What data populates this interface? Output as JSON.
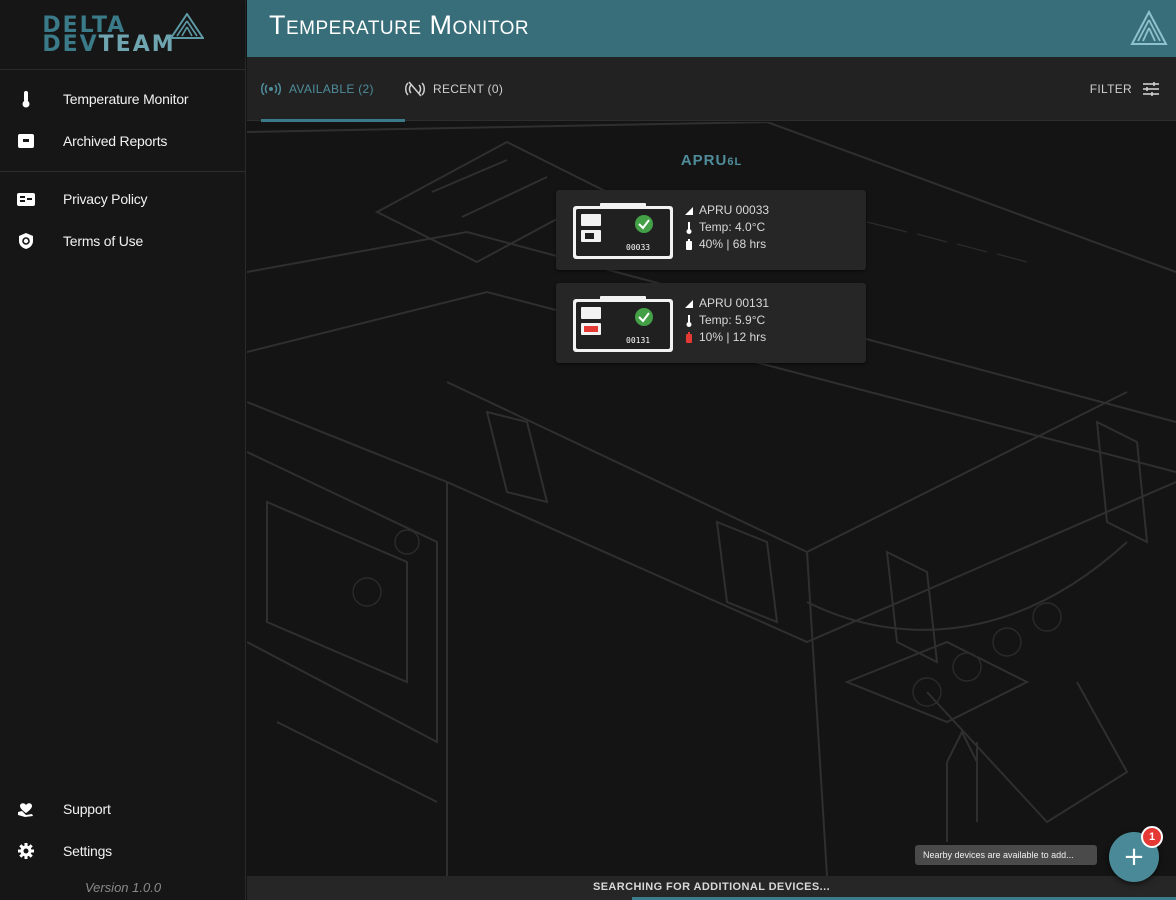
{
  "brand": {
    "line1": "DELTA",
    "line2_a": "DEV",
    "line2_b": "TEAM",
    "accent": "#386e7a"
  },
  "header": {
    "title": "Temperature Monitor"
  },
  "sidebar": {
    "items": [
      {
        "label": "Temperature Monitor",
        "icon": "thermometer-icon"
      },
      {
        "label": "Archived Reports",
        "icon": "archive-icon"
      },
      {
        "label": "Privacy Policy",
        "icon": "id-card-icon"
      },
      {
        "label": "Terms of Use",
        "icon": "shield-icon"
      },
      {
        "label": "Support",
        "icon": "hand-heart-icon"
      },
      {
        "label": "Settings",
        "icon": "gear-icon"
      }
    ],
    "version": "Version 1.0.0"
  },
  "tabs": [
    {
      "label": "AVAILABLE (2)",
      "icon": "broadcast-icon",
      "active": true
    },
    {
      "label": "RECENT (0)",
      "icon": "broadcast-off-icon",
      "active": false
    }
  ],
  "filter": {
    "label": "FILTER",
    "icon": "sliders-icon"
  },
  "main": {
    "group_label": "APRU",
    "group_label_sub": "6L",
    "devices": [
      {
        "thumb_id": "00033",
        "name": "APRU  00033",
        "temp": "Temp: 4.0°C",
        "battery": "40% | 68 hrs",
        "status": "ok",
        "battery_color": "#ffffff"
      },
      {
        "thumb_id": "00131",
        "name": "APRU  00131",
        "temp": "Temp: 5.9°C",
        "battery": "10% | 12 hrs",
        "status": "ok",
        "battery_color": "#e53935"
      }
    ]
  },
  "footer": {
    "status": "SEARCHING FOR ADDITIONAL DEVICES...",
    "tooltip": "Nearby devices are available to add...",
    "fab_icon": "plus-icon",
    "badge_count": "1"
  }
}
